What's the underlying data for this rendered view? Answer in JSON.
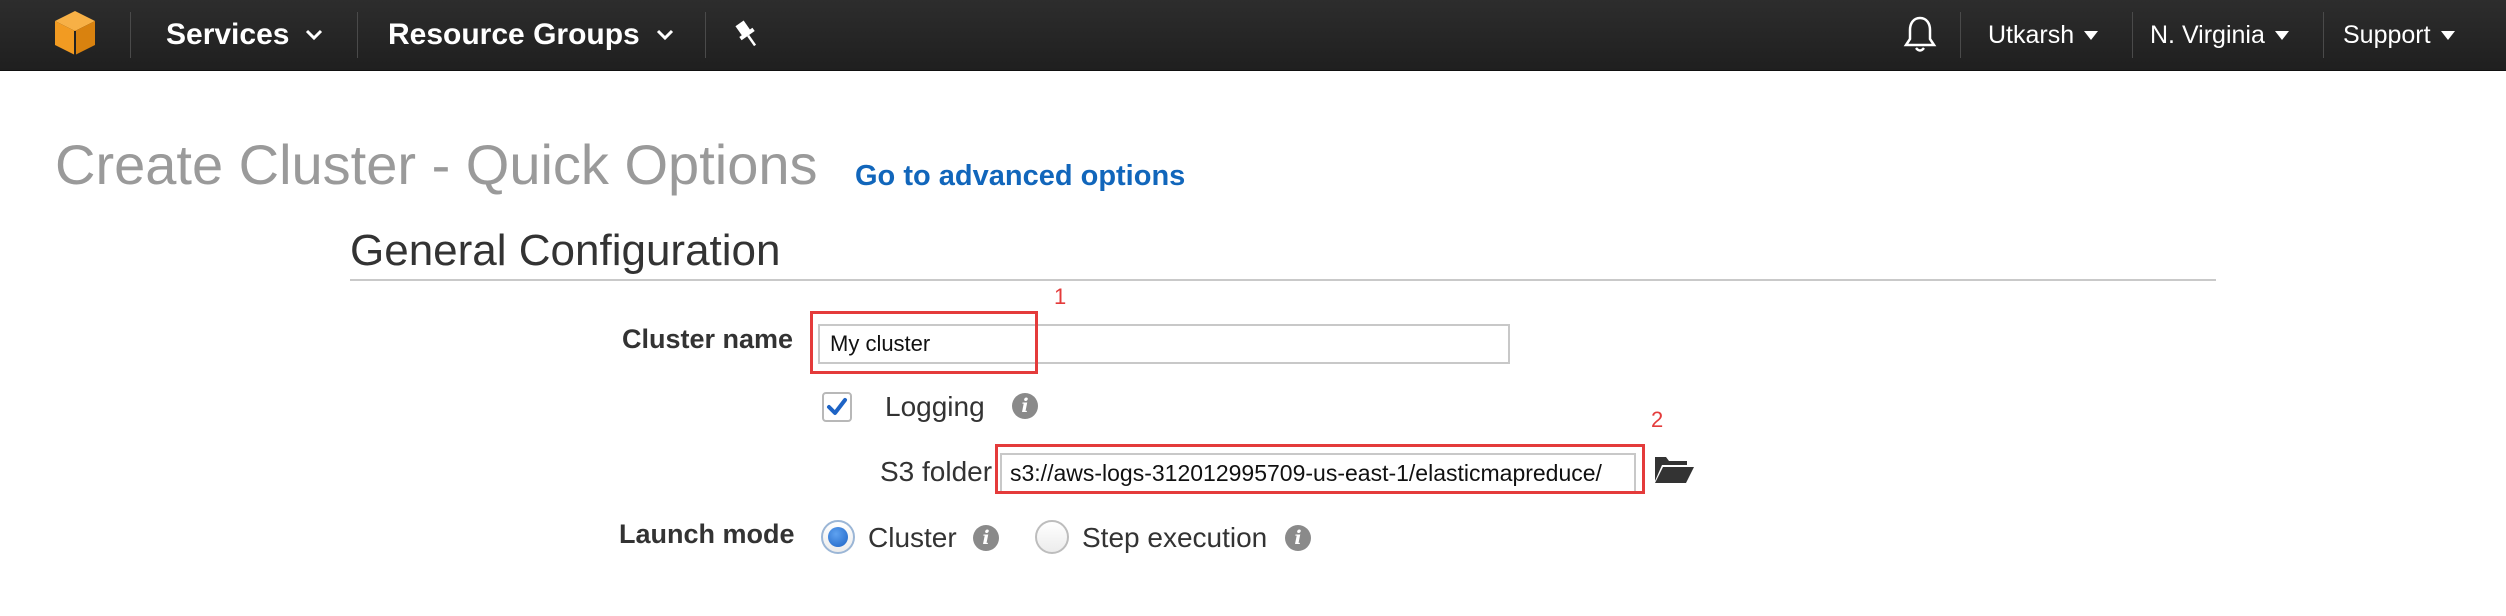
{
  "nav": {
    "services_label": "Services",
    "resource_groups_label": "Resource Groups",
    "user_label": "Utkarsh",
    "region_label": "N. Virginia",
    "support_label": "Support"
  },
  "page": {
    "title": "Create Cluster - Quick Options",
    "advanced_link": "Go to advanced options"
  },
  "section": {
    "title": "General Configuration"
  },
  "form": {
    "cluster_name_label": "Cluster name",
    "cluster_name_value": "My cluster",
    "logging_label": "Logging",
    "logging_checked": true,
    "s3_folder_label": "S3 folder",
    "s3_folder_value": "s3://aws-logs-312012995709-us-east-1/elasticmapreduce/",
    "launch_mode_label": "Launch mode",
    "launch_mode_options": [
      "Cluster",
      "Step execution"
    ],
    "launch_mode_selected": "Cluster"
  },
  "annotations": {
    "box1_number": "1",
    "box2_number": "2",
    "color": "#e43b3b"
  },
  "colors": {
    "navbar": "#232323",
    "link": "#1166bb",
    "title_gray": "#9a9a9a",
    "logo_orange": "#f29b22"
  },
  "icons": {
    "logo": "aws-cube-logo",
    "pin": "pushpin-icon",
    "notifications": "bell-icon",
    "info": "info-icon",
    "browse": "open-folder-icon"
  }
}
